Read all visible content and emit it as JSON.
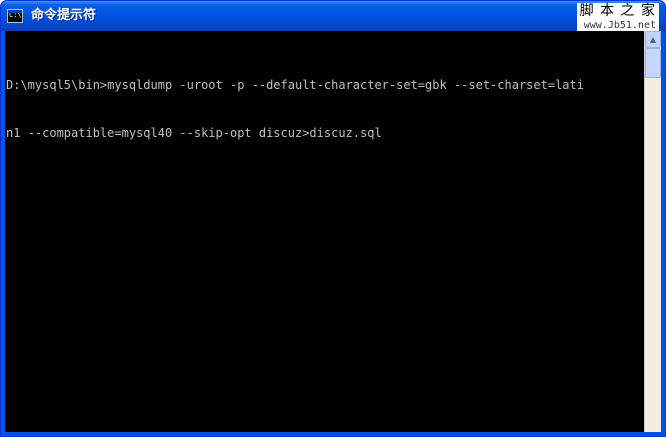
{
  "window": {
    "title": "命令提示符",
    "icon": "console-app-icon",
    "icon_label": "C:\\"
  },
  "watermark": {
    "title": "脚 本 之 家",
    "url": "www.Jb51.net"
  },
  "console": {
    "lines": [
      "D:\\mysql5\\bin>mysqldump -uroot -p --default-character-set=gbk --set-charset=lati",
      "n1 --compatible=mysql40 --skip-opt discuz>discuz.sql"
    ]
  },
  "scrollbar": {
    "up_icon": "arrow-up-icon"
  },
  "colors": {
    "titlebar": "#0054e3",
    "console_bg": "#000000",
    "console_text": "#c0c0c0"
  }
}
